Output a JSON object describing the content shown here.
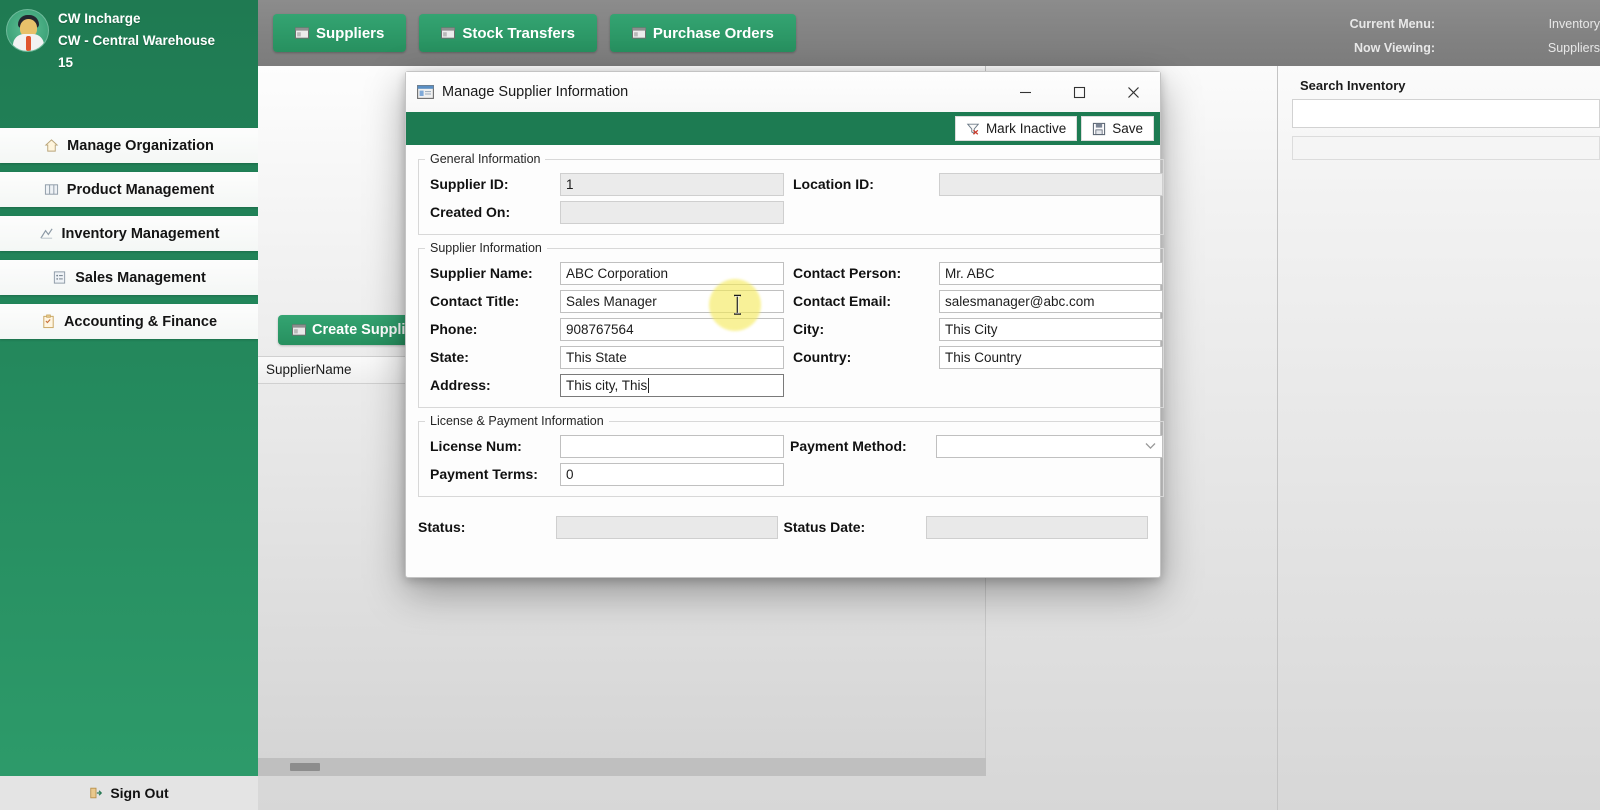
{
  "sidebar": {
    "user": {
      "role": "CW Incharge",
      "warehouse": "CW - Central Warehouse",
      "id": "15"
    },
    "avatar_name": "user-avatar",
    "items": [
      {
        "label": "Manage Organization",
        "icon": "home-icon"
      },
      {
        "label": "Product Management",
        "icon": "grid-icon"
      },
      {
        "label": "Inventory Management",
        "icon": "chart-icon"
      },
      {
        "label": "Sales Management",
        "icon": "list-icon"
      },
      {
        "label": "Accounting & Finance",
        "icon": "clipboard-icon"
      }
    ],
    "sign_out": "Sign Out"
  },
  "topbar": {
    "tabs": [
      {
        "label": "Suppliers",
        "icon": "window-icon"
      },
      {
        "label": "Stock Transfers",
        "icon": "window-icon"
      },
      {
        "label": "Purchase Orders",
        "icon": "window-icon"
      }
    ],
    "info": [
      {
        "label": "Current Menu:",
        "value": "Inventory"
      },
      {
        "label": "Now Viewing:",
        "value": "Suppliers"
      }
    ]
  },
  "background": {
    "create_button": "Create Suppli",
    "grid_header": "SupplierName",
    "search_label": "Search Inventory"
  },
  "dialog": {
    "title": "Manage Supplier Information",
    "title_icon": "form-window-icon",
    "window_buttons": {
      "minimize": "minimize-button",
      "maximize": "maximize-button",
      "close": "close-button"
    },
    "toolbar": {
      "mark_inactive": "Mark Inactive",
      "save": "Save"
    },
    "groups": [
      {
        "legend": "General Information",
        "rows": [
          {
            "left": {
              "label": "Supplier ID:",
              "value": "1",
              "readonly": true
            },
            "right": {
              "label": "Location ID:",
              "value": "",
              "readonly": true
            }
          },
          {
            "left": {
              "label": "Created On:",
              "value": "",
              "readonly": true
            },
            "right": null
          }
        ]
      },
      {
        "legend": "Supplier Information",
        "rows": [
          {
            "left": {
              "label": "Supplier Name:",
              "value": "ABC Corporation",
              "readonly": false
            },
            "right": {
              "label": "Contact Person:",
              "value": "Mr. ABC",
              "readonly": false
            }
          },
          {
            "left": {
              "label": "Contact Title:",
              "value": "Sales Manager",
              "readonly": false
            },
            "right": {
              "label": "Contact Email:",
              "value": "salesmanager@abc.com",
              "readonly": false
            }
          },
          {
            "left": {
              "label": "Phone:",
              "value": "908767564",
              "readonly": false
            },
            "right": {
              "label": "City:",
              "value": "This City",
              "readonly": false
            }
          },
          {
            "left": {
              "label": "State:",
              "value": "This State",
              "readonly": false
            },
            "right": {
              "label": "Country:",
              "value": "This Country",
              "readonly": false
            }
          },
          {
            "left": {
              "label": "Address:",
              "value": "This city, This",
              "readonly": false,
              "focused": true
            },
            "right": null
          }
        ]
      },
      {
        "legend": "License & Payment Information",
        "rows": [
          {
            "left": {
              "label": "License Num:",
              "value": "",
              "readonly": false
            },
            "right": {
              "label": "Payment Method:",
              "value": "",
              "readonly": false,
              "dropdown": true
            }
          },
          {
            "left": {
              "label": "Payment Terms:",
              "value": "0",
              "readonly": false
            },
            "right": null
          }
        ]
      }
    ],
    "status": {
      "label": "Status:",
      "value": "",
      "date_label": "Status Date:",
      "date_value": ""
    }
  },
  "colors": {
    "brand_green": "#1d7b52",
    "button_green": "#2e9c6b",
    "topbar_gray": "#828282",
    "cursor_highlight": "#f5ea5a"
  }
}
